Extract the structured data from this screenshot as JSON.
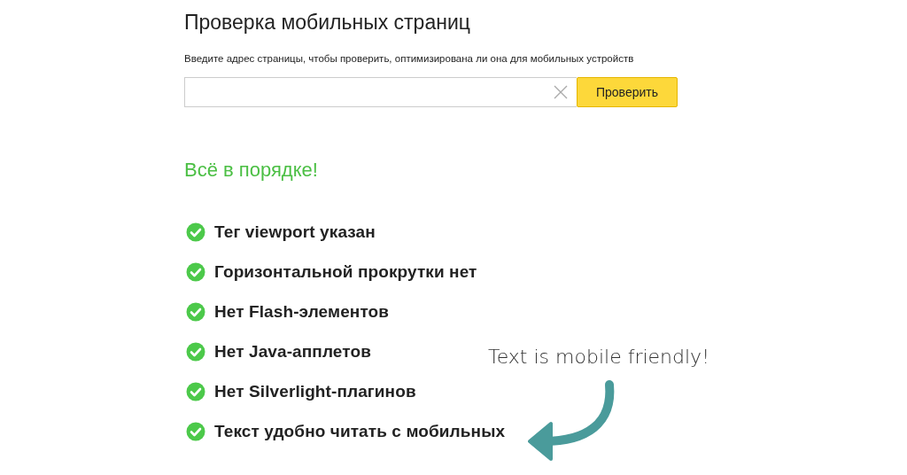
{
  "title": "Проверка мобильных страниц",
  "instruction": "Введите адрес страницы, чтобы проверить, оптимизирована ли она для мобильных устройств",
  "check_button": "Проверить",
  "result_heading": "Всё в порядке!",
  "checks": [
    {
      "label": "Тег viewport указан",
      "passed": true
    },
    {
      "label": "Горизонтальной прокрутки нет",
      "passed": true
    },
    {
      "label": "Нет Flash-элементов",
      "passed": true
    },
    {
      "label": "Нет Java-апплетов",
      "passed": true
    },
    {
      "label": "Нет Silverlight-плагинов",
      "passed": true
    },
    {
      "label": "Текст удобно читать с мобильных",
      "passed": true
    }
  ],
  "annotation": "Text is mobile friendly!"
}
